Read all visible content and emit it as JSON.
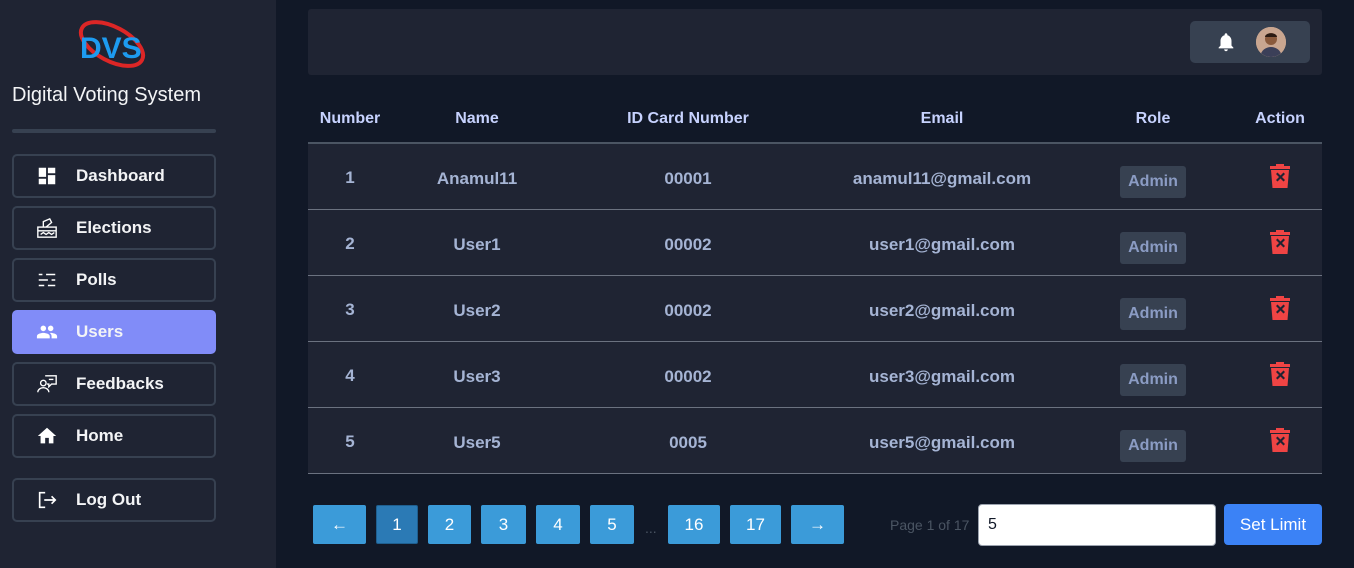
{
  "app": {
    "title": "Digital Voting System",
    "logo_text": "DVS"
  },
  "sidebar": {
    "items": [
      {
        "label": "Dashboard",
        "icon": "dashboard-icon",
        "active": false
      },
      {
        "label": "Elections",
        "icon": "ballot-box-icon",
        "active": false
      },
      {
        "label": "Polls",
        "icon": "poll-list-icon",
        "active": false
      },
      {
        "label": "Users",
        "icon": "users-icon",
        "active": true
      },
      {
        "label": "Feedbacks",
        "icon": "feedback-icon",
        "active": false
      },
      {
        "label": "Home",
        "icon": "home-icon",
        "active": false
      }
    ],
    "logout": {
      "label": "Log Out",
      "icon": "logout-icon"
    }
  },
  "header": {
    "icons": [
      "bell-icon",
      "avatar"
    ]
  },
  "table": {
    "columns": [
      "Number",
      "Name",
      "ID Card Number",
      "Email",
      "Role",
      "Action"
    ],
    "rows": [
      {
        "number": "1",
        "name": "Anamul11",
        "id_card": "00001",
        "email": "anamul11@gmail.com",
        "role": "Admin"
      },
      {
        "number": "2",
        "name": "User1",
        "id_card": "00002",
        "email": "user1@gmail.com",
        "role": "Admin"
      },
      {
        "number": "3",
        "name": "User2",
        "id_card": "00002",
        "email": "user2@gmail.com",
        "role": "Admin"
      },
      {
        "number": "4",
        "name": "User3",
        "id_card": "00002",
        "email": "user3@gmail.com",
        "role": "Admin"
      },
      {
        "number": "5",
        "name": "User5",
        "id_card": "0005",
        "email": "user5@gmail.com",
        "role": "Admin"
      }
    ]
  },
  "pagination": {
    "prev": "←",
    "pages": [
      "1",
      "2",
      "3",
      "4",
      "5"
    ],
    "ellipsis": "...",
    "tail_pages": [
      "16",
      "17"
    ],
    "next": "→",
    "current": "1",
    "page_info": "Page 1 of 17",
    "limit_value": "5",
    "set_limit_label": "Set Limit"
  },
  "colors": {
    "background": "#111827",
    "panel": "#1f2433",
    "active_nav": "#818cf8",
    "delete": "#ef4444",
    "page_button": "#3b9bd9",
    "primary": "#3b82f6"
  }
}
